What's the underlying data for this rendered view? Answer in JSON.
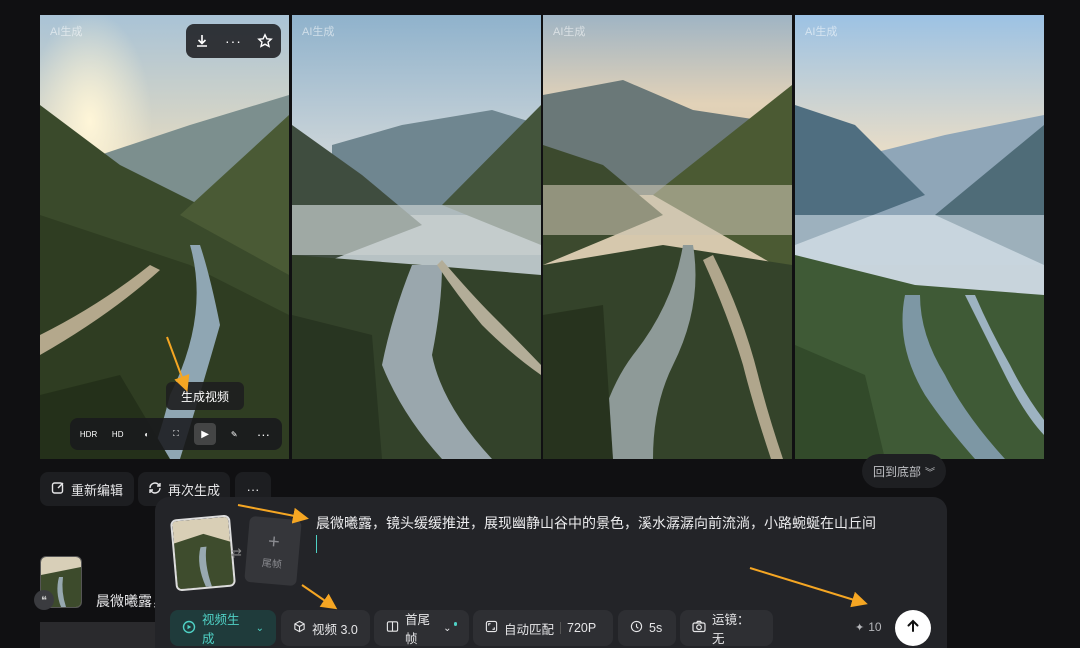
{
  "gallery": {
    "ai_tag": "AI生成",
    "image_actions": {
      "download_icon": "download-icon",
      "more_icon": "more-icon",
      "favorite_icon": "star-icon"
    },
    "toolbar": {
      "items": [
        {
          "name": "hdr-icon",
          "glyph": "HDR"
        },
        {
          "name": "hd-icon",
          "glyph": "HD"
        },
        {
          "name": "palette-icon",
          "glyph": "◐"
        },
        {
          "name": "expand-icon",
          "glyph": "⛶"
        },
        {
          "name": "play-video-icon",
          "glyph": "▶"
        },
        {
          "name": "eraser-icon",
          "glyph": "✎"
        },
        {
          "name": "more-icon",
          "glyph": "···"
        }
      ],
      "tooltip": "生成视频"
    }
  },
  "actions": {
    "reedit_label": "重新编辑",
    "regenerate_label": "再次生成",
    "more_label": "···",
    "back_to_bottom_label": "回到底部"
  },
  "history": {
    "prompt_preview": "晨微曦露，",
    "quote_icon": "❝"
  },
  "composer": {
    "prompt_text": "晨微曦露，镜头缓缓推进，展现幽静山谷中的景色，溪水潺潺向前流淌，小路蜿蜒在山丘间",
    "end_frame_label": "尾帧",
    "swap_icon": "⇄",
    "chips": {
      "mode": "视频生成",
      "model": "视频 3.0",
      "frames": "首尾帧",
      "ratio": "自动匹配",
      "resolution": "720P",
      "duration": "5s",
      "camera": "运镜：无"
    },
    "credits": "10",
    "accent_color": "#4fd1c5"
  }
}
